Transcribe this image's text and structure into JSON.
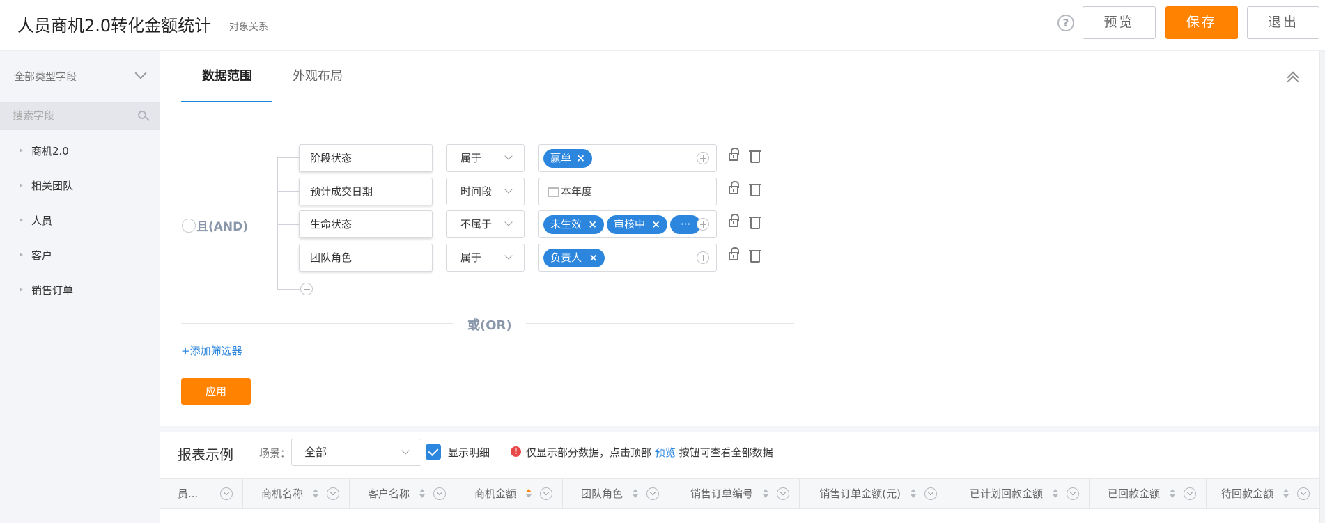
{
  "header": {
    "title": "人员商机2.0转化金额统计",
    "subtitle": "对象关系",
    "help_icon_text": "?",
    "preview_label": "预览",
    "save_label": "保存",
    "exit_label": "退出"
  },
  "sidebar": {
    "field_type_select": "全部类型字段",
    "search_placeholder": "搜索字段",
    "items": [
      {
        "label": "商机2.0"
      },
      {
        "label": "相关团队"
      },
      {
        "label": "人员"
      },
      {
        "label": "客户"
      },
      {
        "label": "销售订单"
      }
    ]
  },
  "tabs": [
    {
      "label": "数据范围",
      "active": true
    },
    {
      "label": "外观布局",
      "active": false
    }
  ],
  "filter": {
    "and_label": "且(AND)",
    "or_label": "或(OR)",
    "add_filter_label": "+添加筛选器",
    "apply_label": "应用",
    "conditions": [
      {
        "field": "阶段状态",
        "operator": "属于",
        "chips": [
          "赢单"
        ],
        "text": ""
      },
      {
        "field": "预计成交日期",
        "operator": "时间段",
        "chips": [],
        "text": "本年度"
      },
      {
        "field": "生命状态",
        "operator": "不属于",
        "chips": [
          "未生效",
          "审核中"
        ],
        "more": "···",
        "text": ""
      },
      {
        "field": "团队角色",
        "operator": "属于",
        "chips": [
          "负责人"
        ],
        "text": ""
      }
    ]
  },
  "report": {
    "title": "报表示例",
    "scene_label": "场景：",
    "scene_value": "全部",
    "show_detail_label": "显示明细",
    "show_detail_checked": true,
    "warn_icon_text": "!",
    "notice_before": "仅显示部分数据，点击顶部",
    "notice_link": "预览",
    "notice_after": "按钮可查看全部数据",
    "columns": [
      {
        "label": "员..."
      },
      {
        "label": "商机名称"
      },
      {
        "label": "客户名称"
      },
      {
        "label": "商机金额",
        "sorted": "asc"
      },
      {
        "label": "团队角色"
      },
      {
        "label": "销售订单编号"
      },
      {
        "label": "销售订单金额(元)"
      },
      {
        "label": "已计划回款金额"
      },
      {
        "label": "已回款金额"
      },
      {
        "label": "待回款金额"
      }
    ]
  },
  "colors": {
    "accent_orange": "#ff8200",
    "chip_blue": "#2c86de",
    "link_blue": "#2c86de",
    "warn_red": "#e84848"
  }
}
